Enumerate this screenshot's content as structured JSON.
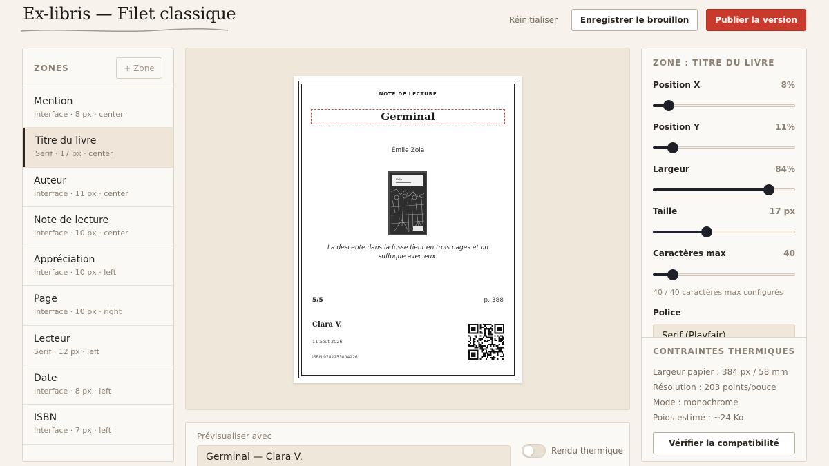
{
  "header": {
    "title": "Ex-libris — Filet classique",
    "reset_label": "Réinitialiser",
    "save_draft_label": "Enregistrer le brouillon",
    "publish_label": "Publier la version"
  },
  "zones": {
    "title": "ZONES",
    "add_label": "+ Zone",
    "items": [
      {
        "name": "Mention",
        "meta": "Interface · 8 px · center",
        "active": false
      },
      {
        "name": "Titre du livre",
        "meta": "Serif · 17 px · center",
        "active": true
      },
      {
        "name": "Auteur",
        "meta": "Interface · 11 px · center",
        "active": false
      },
      {
        "name": "Note de lecture",
        "meta": "Interface · 10 px · center",
        "active": false
      },
      {
        "name": "Appréciation",
        "meta": "Interface · 10 px · left",
        "active": false
      },
      {
        "name": "Page",
        "meta": "Interface · 10 px · right",
        "active": false
      },
      {
        "name": "Lecteur",
        "meta": "Serif · 12 px · left",
        "active": false
      },
      {
        "name": "Date",
        "meta": "Interface · 8 px · left",
        "active": false
      },
      {
        "name": "ISBN",
        "meta": "Interface · 7 px · left",
        "active": false
      }
    ]
  },
  "receipt": {
    "mention": "NOTE DE LECTURE",
    "book_title": "Germinal",
    "author": "Émile Zola",
    "cover_caption": "Zola",
    "reading_note": "La descente dans la fosse tient en trois pages et on suffoque avec eux.",
    "rating": "5/5",
    "page": "p. 388",
    "reader": "Clara V.",
    "date": "11 août 2026",
    "isbn": "ISBN 9782253004226"
  },
  "preview": {
    "label": "Prévisualiser avec",
    "selected": "Germinal — Clara V.",
    "toggle_label": "Rendu thermique",
    "toggle_on": false
  },
  "zone_settings": {
    "title": "ZONE : TITRE DU LIVRE",
    "properties": [
      {
        "label": "Position X",
        "display": "8%",
        "fraction": 0.08
      },
      {
        "label": "Position Y",
        "display": "11%",
        "fraction": 0.11
      },
      {
        "label": "Largeur",
        "display": "84%",
        "fraction": 0.84
      },
      {
        "label": "Taille",
        "display": "17 px",
        "fraction": 0.37
      },
      {
        "label": "Caractères max",
        "display": "40",
        "fraction": 0.11
      }
    ],
    "max_hint": "40 / 40 caractères max configurés",
    "font_label": "Police",
    "font_value": "Serif (Playfair)"
  },
  "thermal": {
    "title": "CONTRAINTES THERMIQUES",
    "lines": [
      "Largeur papier : 384 px / 58 mm",
      "Résolution : 203 points/pouce",
      "Mode : monochrome",
      "Poids estimé : ~24 Ko"
    ],
    "verify_label": "Vérifier la compatibilité"
  },
  "colors": {
    "background": "#f7f3ec",
    "accent": "#c83a2c",
    "ink": "#2a2520",
    "muted": "#8d8174"
  }
}
